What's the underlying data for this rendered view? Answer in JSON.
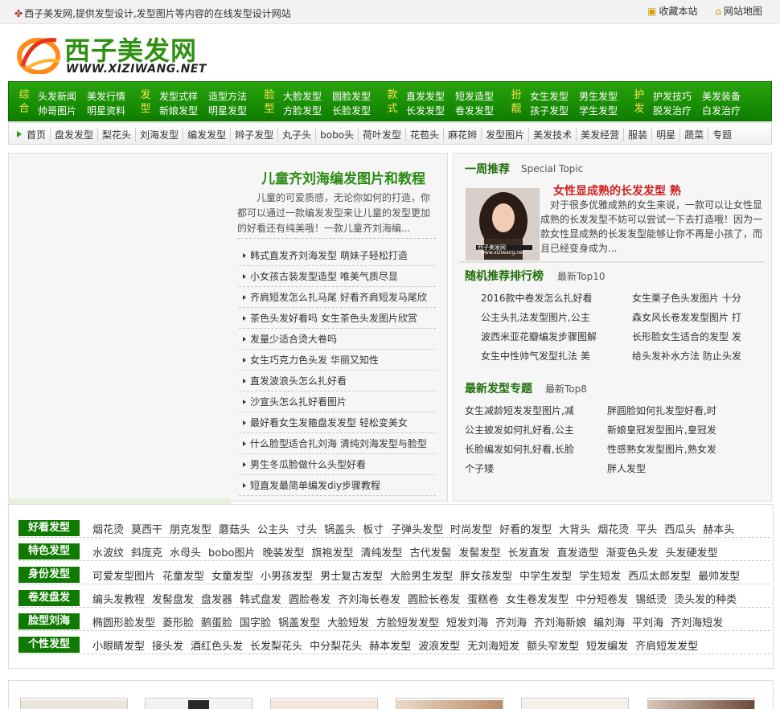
{
  "topbar": {
    "slogan": "西子美发网,提供发型设计,发型图片等内容的在线发型设计网站",
    "bookmark": "收藏本站",
    "sitemap": "网站地图"
  },
  "logo": {
    "cn": "西子美发网",
    "en": "WWW.XIZIWANG.NET"
  },
  "main_nav": [
    {
      "cat": [
        "综",
        "合"
      ],
      "items": [
        [
          "头发新闻",
          "美发行情"
        ],
        [
          "帅哥图片",
          "明星资料"
        ]
      ]
    },
    {
      "cat": [
        "发",
        "型"
      ],
      "items": [
        [
          "发型式样",
          "造型方法"
        ],
        [
          "新娘发型",
          "明星发型"
        ]
      ]
    },
    {
      "cat": [
        "脸",
        "型"
      ],
      "items": [
        [
          "大脸发型",
          "圆脸发型"
        ],
        [
          "方脸发型",
          "长脸发型"
        ]
      ]
    },
    {
      "cat": [
        "款",
        "式"
      ],
      "items": [
        [
          "直发发型",
          "短发造型"
        ],
        [
          "长发发型",
          "卷发发型"
        ]
      ]
    },
    {
      "cat": [
        "扮",
        "靓"
      ],
      "items": [
        [
          "女生发型",
          "男生发型"
        ],
        [
          "孩子发型",
          "学生发型"
        ]
      ]
    },
    {
      "cat": [
        "护",
        "发"
      ],
      "items": [
        [
          "护发技巧",
          "美发装备"
        ],
        [
          "脱发治疗",
          "白发治疗"
        ]
      ]
    }
  ],
  "sub_nav": [
    "首页",
    "盘发发型",
    "梨花头",
    "刘海发型",
    "编发发型",
    "辫子发型",
    "丸子头",
    "bobo头",
    "荷叶发型",
    "花苞头",
    "麻花辫",
    "发型图片",
    "美发技术",
    "美发经营",
    "服装",
    "明星",
    "蔬菜",
    "专题"
  ],
  "featured": {
    "title": "儿童齐刘海编发图片和教程",
    "desc": "儿童的可爱质感，无论你如何的打造，你都可以通过一款编发发型来让儿童的发型更加的好看还有纯美哦！一款儿童齐刘海编..."
  },
  "articles": [
    "韩式直发齐刘海发型 萌妹子轻松打造",
    "小女孩古装发型造型 唯美气质尽显",
    "齐肩短发怎么扎马尾 好看齐肩短发马尾欣",
    "茶色头发好看吗 女生茶色头发图片欣赏",
    "发量少适合烫大卷吗",
    "女生巧克力色头发 华丽又知性",
    "直发波浪头怎么扎好看",
    "沙宣头怎么扎好看图片",
    "最好看女生发箍盘发发型 轻松变美女",
    "什么脸型适合扎刘海 清纯刘海发型与脸型",
    "男生冬瓜脸做什么头型好看",
    "短直发最简单编发diy步骤教程"
  ],
  "weekly": {
    "title": "一周推荐",
    "sub": "Special Topic",
    "photo_caption": "西子美发网",
    "photo_url": "www.xiziwang.net",
    "rec_title": "女性显成熟的长发发型 熟",
    "rec_desc": "对于很多优雅成熟的女生来说，一款可以让女性显成熟的长发发型不妨可以尝试一下去打造哦！因为一款女性显成熟的长发发型能够让你不再是小孩了，而且已经变身成为..."
  },
  "random": {
    "title": "随机推荐排行榜",
    "sub": "最新Top10",
    "left": [
      "2016款中卷发怎么扎好看",
      "公主头扎法发型图片,公主",
      "波西米亚花瓣编发步骤图解",
      "女生中性帅气发型扎法 美"
    ],
    "right": [
      "女生栗子色头发图片 十分",
      "森女风长卷发发型图片 打",
      "长形脸女生适合的发型 发",
      "给头发补水方法 防止头发"
    ]
  },
  "topics": {
    "title": "最新发型专题",
    "sub": "最新Top8",
    "left": [
      "女生减龄短发发型图片,减",
      "公主披发如何扎好看,公主",
      "长脸编发如何扎好看,长脸",
      "个子矮"
    ],
    "right": [
      "胖圆脸如何扎发型好看,时",
      "新娘皇冠发型图片,皇冠发",
      "性感熟女发型图片,熟女发",
      "胖人发型"
    ]
  },
  "tag_rows": [
    {
      "label": "好看发型",
      "tags": [
        "烟花烫",
        "莫西干",
        "朋克发型",
        "蘑菇头",
        "公主头",
        "寸头",
        "锅盖头",
        "板寸",
        "子弹头发型",
        "时尚发型",
        "好看的发型",
        "大背头",
        "烟花烫",
        "平头",
        "西瓜头",
        "赫本头"
      ]
    },
    {
      "label": "特色发型",
      "tags": [
        "水波纹",
        "斜庞克",
        "水母头",
        "bobo图片",
        "晚装发型",
        "旗袍发型",
        "清纯发型",
        "古代发髻",
        "发髻发型",
        "长发直发",
        "直发造型",
        "渐变色头发",
        "头发硬发型"
      ]
    },
    {
      "label": "身份发型",
      "tags": [
        "可爱发型图片",
        "花童发型",
        "女童发型",
        "小男孩发型",
        "男士复古发型",
        "大脸男生发型",
        "胖女孩发型",
        "中学生发型",
        "学生短发",
        "西瓜太郎发型",
        "最帅发型"
      ]
    },
    {
      "label": "卷发盘发",
      "tags": [
        "编头发教程",
        "发髻盘发",
        "盘发器",
        "韩式盘发",
        "圆脸卷发",
        "齐刘海长卷发",
        "圆脸长卷发",
        "蛋糕卷",
        "女生卷发发型",
        "中分短卷发",
        "锡纸烫",
        "烫头发的种类"
      ]
    },
    {
      "label": "脸型刘海",
      "tags": [
        "椭圆形脸发型",
        "菱形脸",
        "鹅蛋脸",
        "国字脸",
        "锅盖发型",
        "大脸短发",
        "方脸短发发型",
        "短发刘海",
        "齐刘海",
        "齐刘海新娘",
        "编刘海",
        "平刘海",
        "齐刘海短发"
      ]
    },
    {
      "label": "个性发型",
      "tags": [
        "小眼睛发型",
        "接头发",
        "酒红色头发",
        "长发梨花头",
        "中分梨花头",
        "赫本发型",
        "波浪发型",
        "无刘海短发",
        "额头窄发型",
        "短发编发",
        "齐肩短发发型"
      ]
    }
  ],
  "colors": {
    "brand_green": "#0f7a00",
    "nav_gradient_top": "#2aa40d",
    "highlight_red": "#d11f1f",
    "cat_yellow": "#ffe44a"
  }
}
